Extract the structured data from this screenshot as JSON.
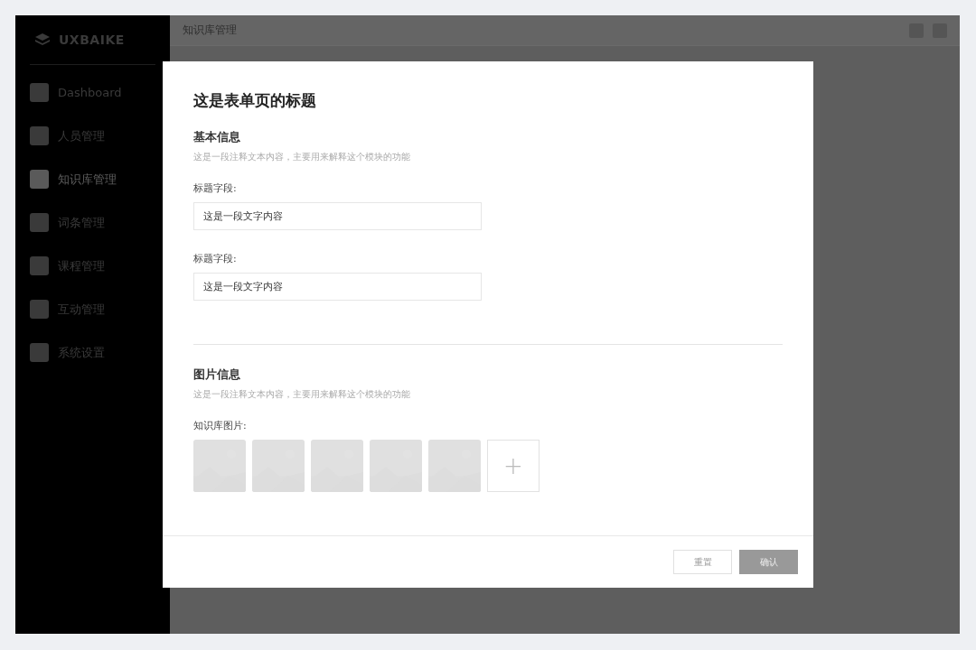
{
  "sidebar": {
    "logo": "UXBAIKE",
    "items": [
      {
        "label": "Dashboard",
        "selected": false
      },
      {
        "label": "人员管理",
        "selected": false
      },
      {
        "label": "知识库管理",
        "selected": true
      },
      {
        "label": "词条管理",
        "selected": false
      },
      {
        "label": "课程管理",
        "selected": false
      },
      {
        "label": "互动管理",
        "selected": false
      },
      {
        "label": "系统设置",
        "selected": false
      }
    ]
  },
  "topbar": {
    "title": "知识库管理"
  },
  "dialog": {
    "title": "这是表单页的标题",
    "sections": [
      {
        "heading": "基本信息",
        "note": "这是一段注释文本内容，主要用来解释这个模块的功能",
        "fields": [
          {
            "label": "标题字段:",
            "value": "这是一段文字内容"
          },
          {
            "label": "标题字段:",
            "value": "这是一段文字内容"
          }
        ]
      },
      {
        "heading": "图片信息",
        "note": "这是一段注释文本内容，主要用来解释这个模块的功能",
        "gallery": {
          "label": "知识库图片:",
          "add": "+"
        }
      }
    ],
    "buttons": [
      {
        "label": "重置",
        "kind": "secondary"
      },
      {
        "label": "确认",
        "kind": "primary"
      }
    ]
  }
}
